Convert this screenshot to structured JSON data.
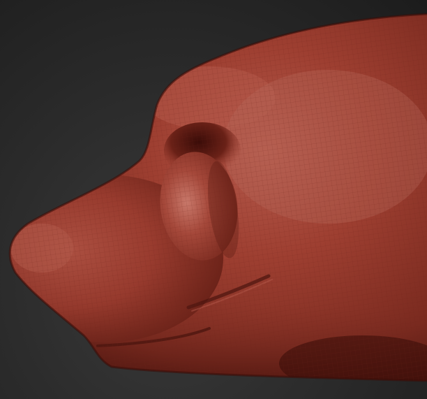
{
  "scene": {
    "subject": "sculpted-animal-head-profile",
    "background_color": "#262626",
    "material_base_color": "#9a3a2c",
    "material_highlight_color": "#c76a5c",
    "material_shadow_color": "#4a140e",
    "wireframe_color": "#6e2418"
  }
}
